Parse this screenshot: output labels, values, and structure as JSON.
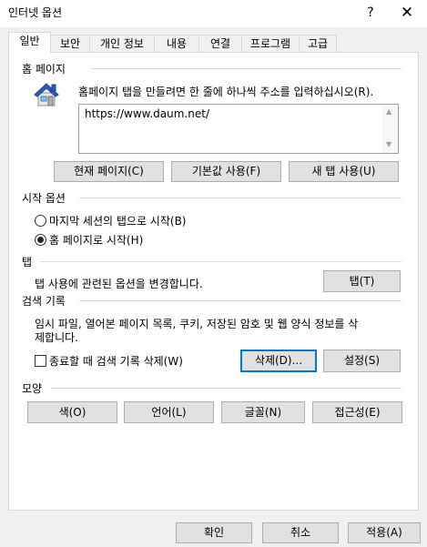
{
  "window": {
    "title": "인터넷 옵션",
    "help": "?",
    "close": "✕"
  },
  "tabs": [
    "일반",
    "보안",
    "개인 정보",
    "내용",
    "연결",
    "프로그램",
    "고급"
  ],
  "home": {
    "section": "홈 페이지",
    "description": "홈페이지 탭을 만들려면 한 줄에 하나씩 주소를 입력하십시오(R).",
    "url": "https://www.daum.net/",
    "use_current": "현재 페이지(C)",
    "use_default": "기본값 사용(F)",
    "use_new_tab": "새 탭 사용(U)"
  },
  "startup": {
    "section": "시작 옵션",
    "option_last_session": "마지막 세션의 탭으로 시작(B)",
    "option_home_page": "홈 페이지로 시작(H)",
    "selected": "home_page"
  },
  "tabs_section": {
    "section": "탭",
    "description": "탭 사용에 관련된 옵션을 변경합니다.",
    "button": "탭(T)"
  },
  "history": {
    "section": "검색 기록",
    "description_line1": "임시 파일, 열어본 페이지 목록, 쿠키, 저장된 암호 및 웹 양식 정보를 삭",
    "description_line2": "제합니다.",
    "delete_on_exit": "종료할 때 검색 기록 삭제(W)",
    "delete_on_exit_checked": false,
    "delete_button": "삭제(D)...",
    "settings_button": "설정(S)"
  },
  "appearance": {
    "section": "모양",
    "colors": "색(O)",
    "languages": "언어(L)",
    "fonts": "글꼴(N)",
    "accessibility": "접근성(E)"
  },
  "footer": {
    "ok": "확인",
    "cancel": "취소",
    "apply": "적용(A)"
  },
  "colors": {
    "focus_border": "#0078d7",
    "button_bg": "#e1e1e1",
    "icon_roof": "#2a5fc2"
  },
  "icons": {
    "home": "house-icon",
    "scroll_up": "scroll-up-arrow",
    "scroll_down": "scroll-down-arrow"
  }
}
